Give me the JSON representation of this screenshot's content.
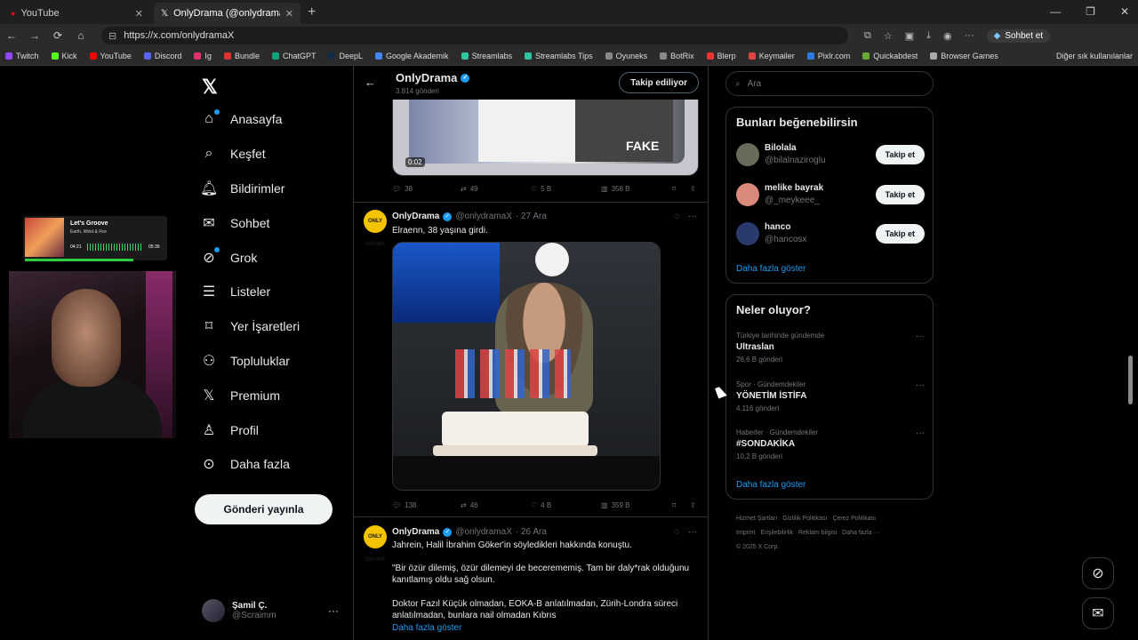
{
  "browser": {
    "tabs": [
      {
        "title": "YouTube",
        "icon": "youtube-icon"
      },
      {
        "title": "OnlyDrama (@onlydramaX) / X",
        "icon": "x-icon"
      }
    ],
    "url": "https://x.com/onlydramaX",
    "assistant_label": "Sohbet et",
    "bookmarks": [
      "Twitch",
      "Kick",
      "YouTube",
      "Discord",
      "Ig",
      "Bundle",
      "ChatGPT",
      "DeepL",
      "Google Akademik",
      "Streamlabs",
      "Streamlabs Tips",
      "Oyuneks",
      "BotRix",
      "Blerp",
      "Keymailer",
      "Pixlr.com",
      "Quickabdest",
      "Browser Games"
    ],
    "bookmarks_other": "Diğer sık kullanılanlar"
  },
  "overlay": {
    "song": "Let's Groove",
    "artist": "Earth, Wind & Fire",
    "time_elapsed": "04:21",
    "time_total": "05:39",
    "progress": 0.77
  },
  "sidebar": {
    "items": [
      {
        "label": "Anasayfa",
        "icon": "home-icon"
      },
      {
        "label": "Keşfet",
        "icon": "search-icon"
      },
      {
        "label": "Bildirimler",
        "icon": "bell-icon"
      },
      {
        "label": "Sohbet",
        "icon": "mail-icon"
      },
      {
        "label": "Grok",
        "icon": "grok-icon"
      },
      {
        "label": "Listeler",
        "icon": "list-icon"
      },
      {
        "label": "Yer İşaretleri",
        "icon": "bookmark-icon"
      },
      {
        "label": "Topluluklar",
        "icon": "communities-icon"
      },
      {
        "label": "Premium",
        "icon": "x-icon"
      },
      {
        "label": "Profil",
        "icon": "profile-icon"
      },
      {
        "label": "Daha fazla",
        "icon": "more-circle-icon"
      }
    ],
    "post_button": "Gönderi yayınla",
    "account": {
      "name": "Şamil Ç.",
      "handle": "@Scraimm"
    }
  },
  "profile_header": {
    "name": "OnlyDrama",
    "post_count": "3.814 gönderi",
    "follow_label": "Takip ediliyor"
  },
  "video": {
    "time": "0:02",
    "caption": "FAKE"
  },
  "posts": [
    {
      "replies": "38",
      "reposts": "49",
      "likes": "5 B",
      "views": "358 B"
    },
    {
      "avatar": "ONLY DRAMA",
      "name": "OnlyDrama",
      "handle": "@onlydramaX",
      "date": "· 27 Ara",
      "text": "Elraenn, 38 yaşına girdi.",
      "replies": "138",
      "reposts": "46",
      "likes": "4 B",
      "views": "359 B"
    },
    {
      "avatar": "ONLY DRAMA",
      "name": "OnlyDrama",
      "handle": "@onlydramaX",
      "date": "· 26 Ara",
      "text1": "Jahrein, Halil İbrahim Göker'in söyledikleri hakkında konuştu.",
      "text2": "\"Bir özür dilemiş, özür dilemeyi de becerememiş. Tam bir daly*rak olduğunu kanıtlamış oldu sağ olsun.",
      "text3": "Doktor Fazıl Küçük olmadan, EOKA-B anlatılmadan, Zürih-Londra süreci anlatılmadan, bunlara nail olmadan Kıbrıs",
      "more": "Daha fazla göster"
    }
  ],
  "search": {
    "placeholder": "Ara"
  },
  "suggestions": {
    "title": "Bunları beğenebilirsin",
    "follow_label": "Takip et",
    "users": [
      {
        "name": "Bilolala",
        "handle": "@bilalnaziroglu",
        "color": "#6b6b5a"
      },
      {
        "name": "melike bayrak",
        "handle": "@_meykeee_",
        "color": "#d98a7a"
      },
      {
        "name": "hanco",
        "handle": "@hancosx",
        "color": "#2a3a6a"
      }
    ],
    "show_more": "Daha fazla göster"
  },
  "trends": {
    "title": "Neler oluyor?",
    "items": [
      {
        "context": "Türkiye tarihinde gündemde",
        "name": "Ultraslan",
        "posts": "26,6 B gönderi"
      },
      {
        "context": "Spor · Gündemdekiler",
        "name": "YÖNETİM İSTİFA",
        "posts": "4.116 gönderi"
      },
      {
        "context": "Haberler · Gündemdekiler",
        "name": "#SONDAKİKA",
        "posts": "10,2 B gönderi"
      }
    ],
    "show_more": "Daha fazla göster"
  },
  "footer": {
    "links": [
      "Hizmet Şartları",
      "Gizlilik Politikası",
      "Çerez Politikası",
      "Imprint",
      "Erişilebilirlik",
      "Reklam bilgisi",
      "Daha fazla ···"
    ],
    "copyright": "© 2025 X Corp."
  }
}
